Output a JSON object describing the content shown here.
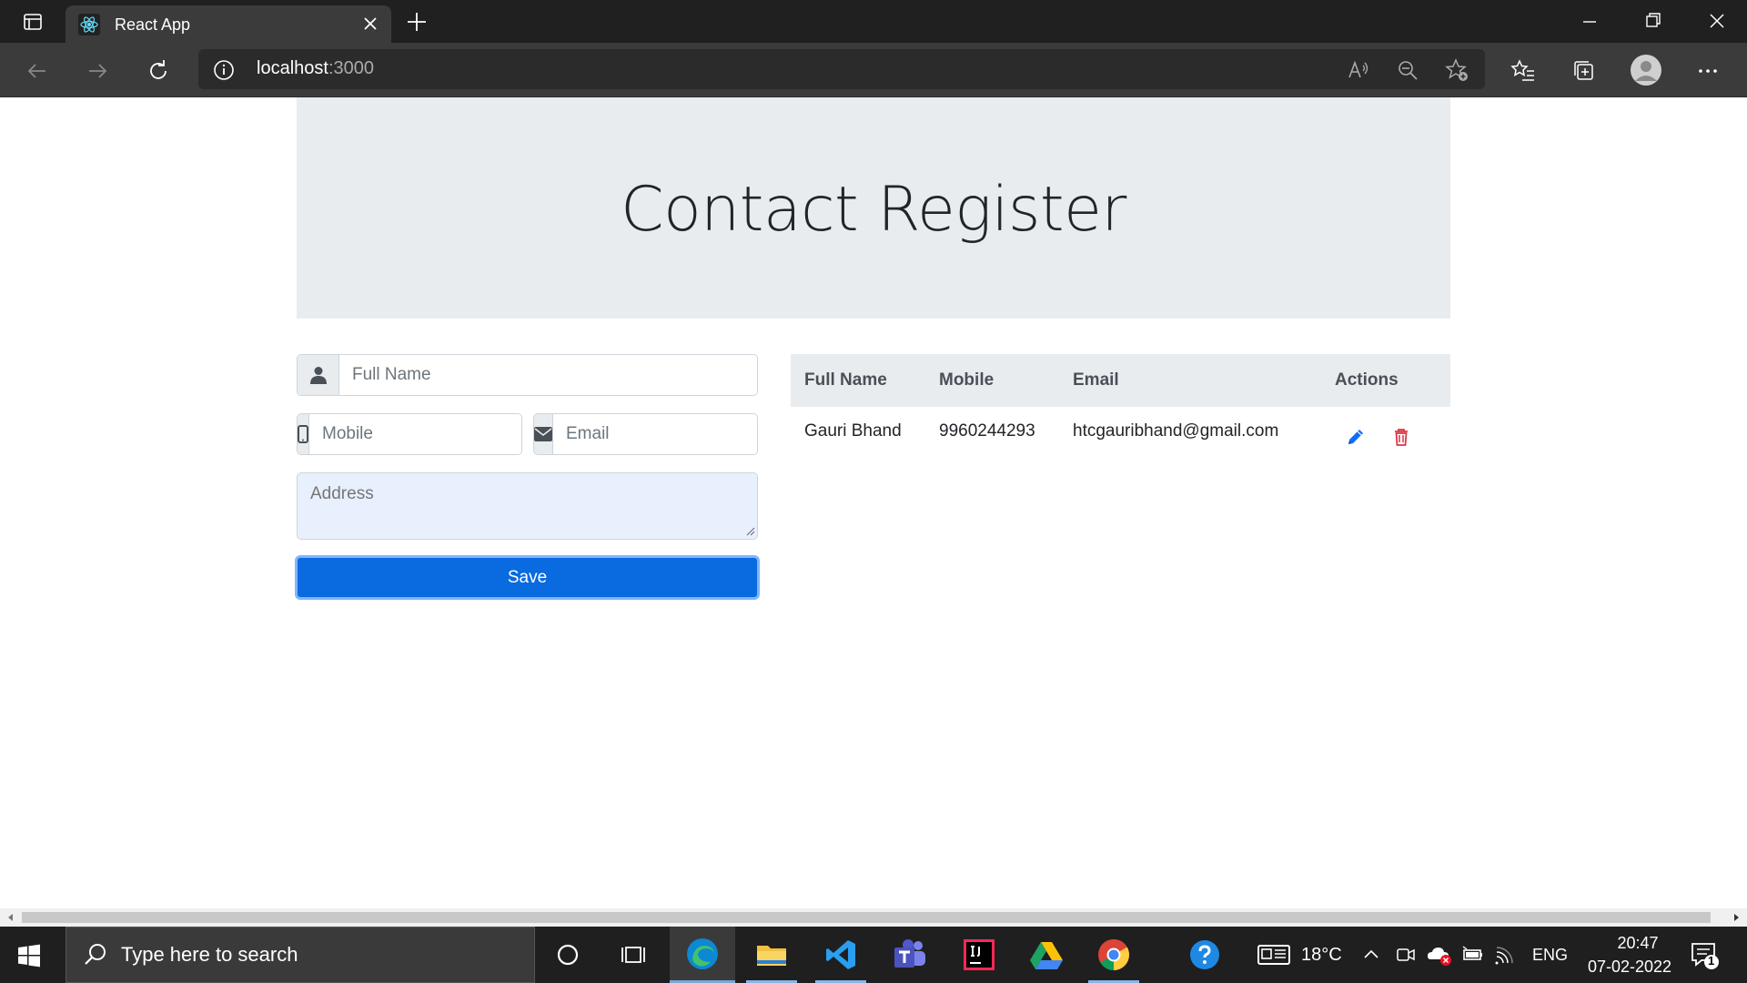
{
  "browser": {
    "tab_title": "React App",
    "url_host": "localhost",
    "url_port": ":3000"
  },
  "page": {
    "title": "Contact Register",
    "form": {
      "fullname_placeholder": "Full Name",
      "mobile_placeholder": "Mobile",
      "email_placeholder": "Email",
      "address_placeholder": "Address",
      "save_label": "Save"
    },
    "table": {
      "headers": [
        "Full Name",
        "Mobile",
        "Email",
        "Actions"
      ],
      "rows": [
        {
          "fullname": "Gauri Bhand",
          "mobile": "9960244293",
          "email": "htcgauribhand@gmail.com"
        }
      ],
      "edit_icon_color": "#0d6efd",
      "delete_icon_color": "#dc3545"
    }
  },
  "taskbar": {
    "search_placeholder": "Type here to search",
    "temperature": "18°C",
    "language": "ENG",
    "time": "20:47",
    "date": "07-02-2022",
    "notification_count": "1",
    "apps": [
      "cortana-icon",
      "task-view-icon",
      "edge-icon",
      "file-explorer-icon",
      "vscode-icon",
      "teams-icon",
      "intellij-icon",
      "google-drive-icon",
      "chrome-icon",
      "help-icon"
    ]
  }
}
